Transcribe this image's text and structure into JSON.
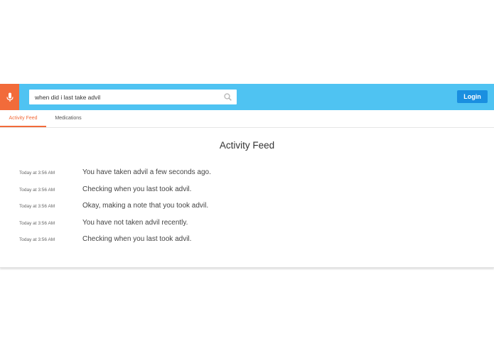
{
  "header": {
    "search": {
      "value": "when did i last take advil",
      "placeholder": ""
    },
    "login_label": "Login",
    "mic_icon": "microphone-icon",
    "search_icon": "search-icon"
  },
  "tabs": [
    {
      "label": "Activity Feed",
      "active": true
    },
    {
      "label": "Medications",
      "active": false
    }
  ],
  "feed": {
    "title": "Activity Feed",
    "items": [
      {
        "time": "Today at 3:56 AM",
        "message": "You have taken advil a few seconds ago."
      },
      {
        "time": "Today at 3:56 AM",
        "message": "Checking when you last took advil."
      },
      {
        "time": "Today at 3:56 AM",
        "message": "Okay, making a note that you took advil."
      },
      {
        "time": "Today at 3:56 AM",
        "message": "You have not taken advil recently."
      },
      {
        "time": "Today at 3:56 AM",
        "message": "Checking when you last took advil."
      }
    ]
  },
  "colors": {
    "header_bg": "#4fc3f2",
    "mic_bg": "#f26b3a",
    "login_bg": "#1a8fe0",
    "active_tab": "#f26b3a"
  }
}
